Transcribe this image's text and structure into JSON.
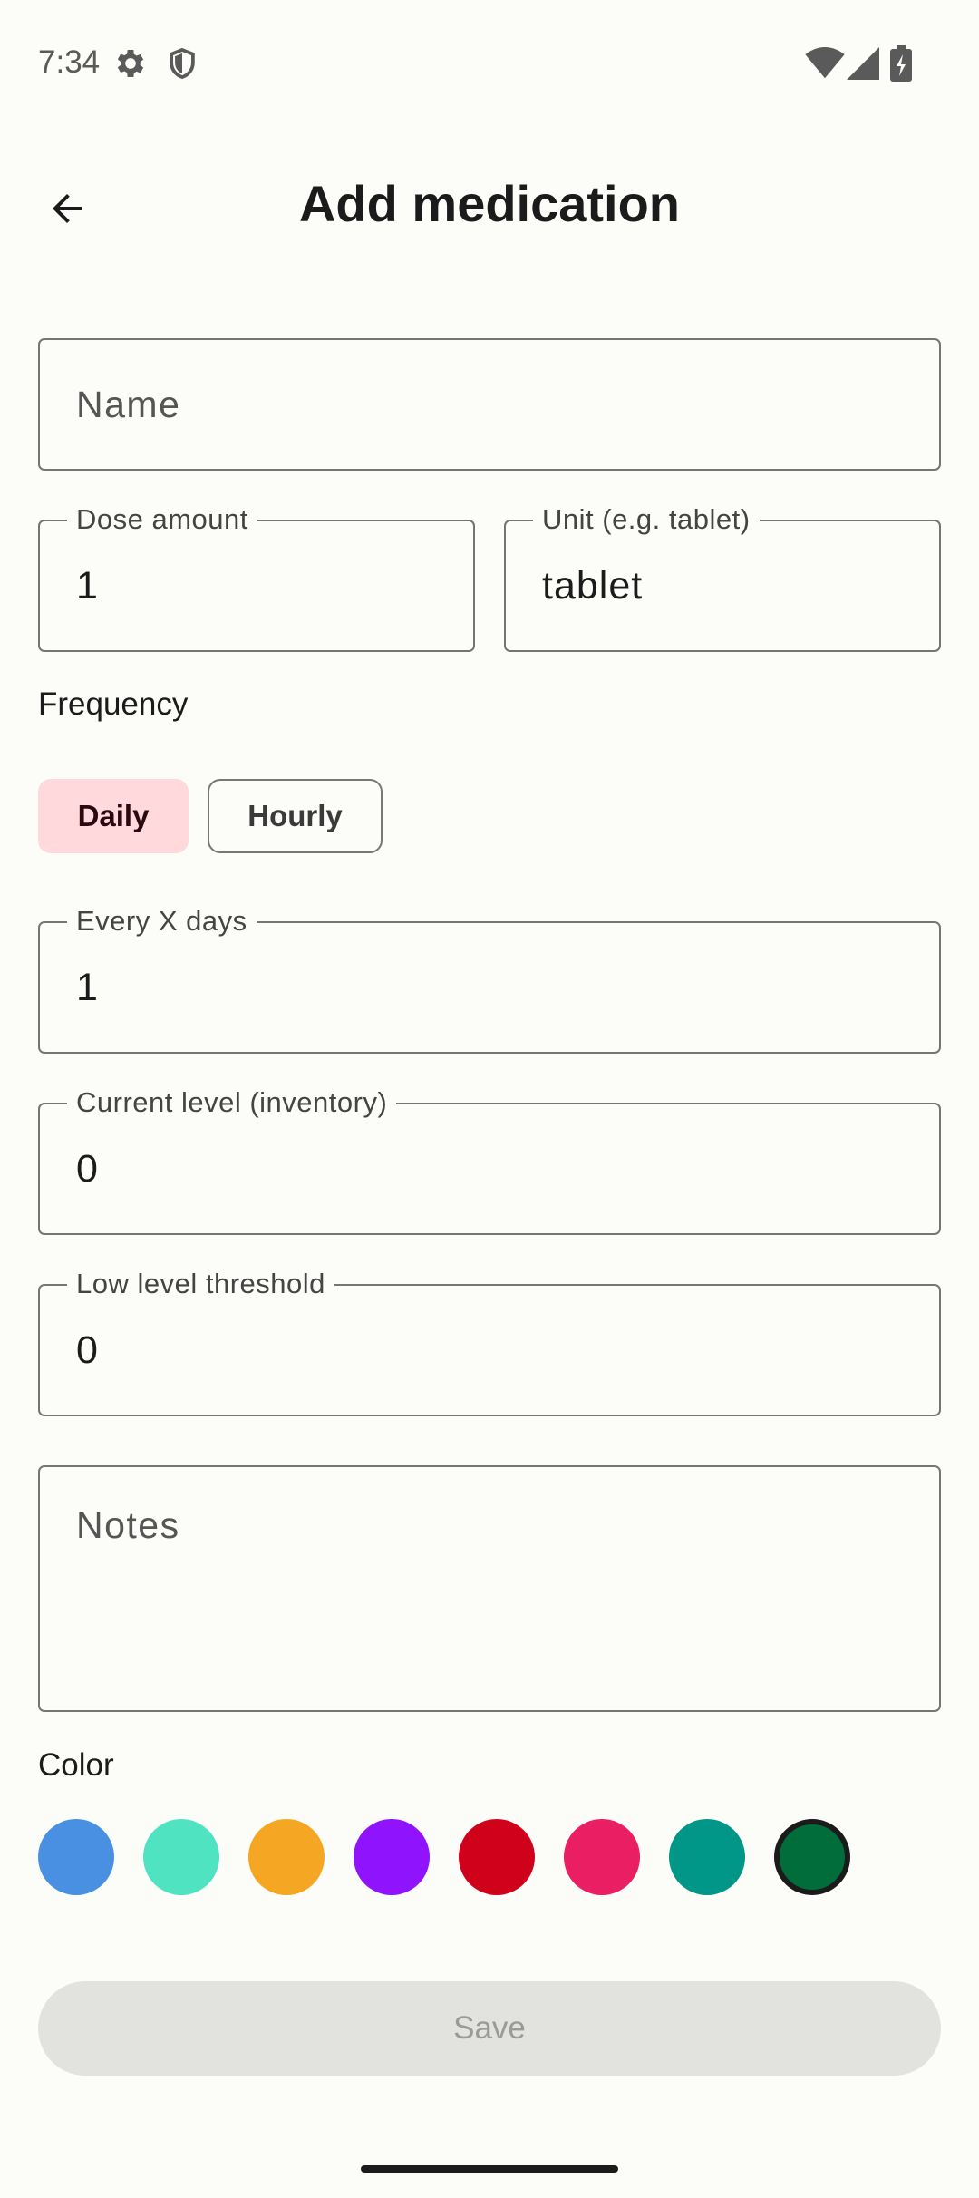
{
  "status_bar": {
    "time": "7:34",
    "icons": [
      "gear-icon",
      "shield-icon",
      "wifi-icon",
      "signal-icon",
      "battery-charging-icon"
    ]
  },
  "top_bar": {
    "title": "Add medication",
    "back_icon": "arrow-back-icon"
  },
  "form": {
    "name": {
      "placeholder": "Name",
      "value": ""
    },
    "dose_amount": {
      "label": "Dose amount",
      "value": "1"
    },
    "unit": {
      "label": "Unit (e.g. tablet)",
      "value": "tablet"
    },
    "frequency": {
      "label": "Frequency",
      "options": [
        {
          "label": "Daily",
          "selected": true
        },
        {
          "label": "Hourly",
          "selected": false
        }
      ]
    },
    "every_x_days": {
      "label": "Every X days",
      "value": "1"
    },
    "current_level": {
      "label": "Current level (inventory)",
      "value": "0"
    },
    "low_threshold": {
      "label": "Low level threshold",
      "value": "0"
    },
    "notes": {
      "placeholder": "Notes",
      "value": ""
    },
    "color": {
      "label": "Color",
      "swatches": [
        "#4a90e2",
        "#50e3c2",
        "#f5a623",
        "#9013fe",
        "#d0021b",
        "#e91e63",
        "#009688",
        "#006d3a"
      ],
      "selected_index": 7
    },
    "save_label": "Save"
  },
  "colors": {
    "background": "#fcfdf8",
    "chip_selected": "#ffd9dc",
    "save_disabled_bg": "#e2e3de"
  }
}
